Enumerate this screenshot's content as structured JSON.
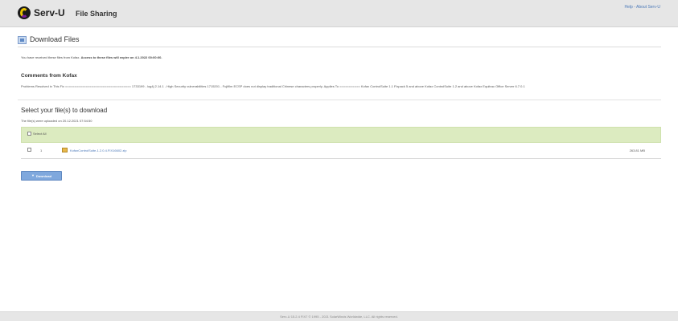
{
  "header": {
    "brand": "Serv-U",
    "app_title": "File Sharing",
    "help_link": "Help",
    "separator": " - ",
    "about_link": "About Serv-U"
  },
  "page": {
    "title": "Download Files",
    "received_text": "You have received these files from Kofax.",
    "expire_text": "Access to these files will expire on 4.1.2022 00:00:00."
  },
  "comments": {
    "heading": "Comments from Kofax",
    "body": "Problems Resolved in This Fix =================================== 1733199 - log4j 2.14.1 - High Security vulnerabilities 1715201 - Fujifilm ECSP does not display traditional Chinese characters properly. Applies To =========== Kofax ControlSuite 1.1 Fixpack 5 and above Kofax ControlSuite 1.2 and above Kofax Equitrac Office Server 6.7.0.1"
  },
  "files_section": {
    "heading": "Select your file(s) to download",
    "uploaded_text": "The file(s) were uploaded on 20.12.2021 07:54:50",
    "select_all_label": "Select All",
    "files": [
      {
        "number": "1",
        "name": "KofaxControlSuite-1.2.0.4.FIX16602.zip",
        "size": "263.81 MB"
      }
    ],
    "download_label": "Download"
  },
  "footer": {
    "text": "Serv-U 15.2.4 FIX7 © 1995 - 2021 SolarWinds Worldwide, LLC. All rights reserved."
  }
}
